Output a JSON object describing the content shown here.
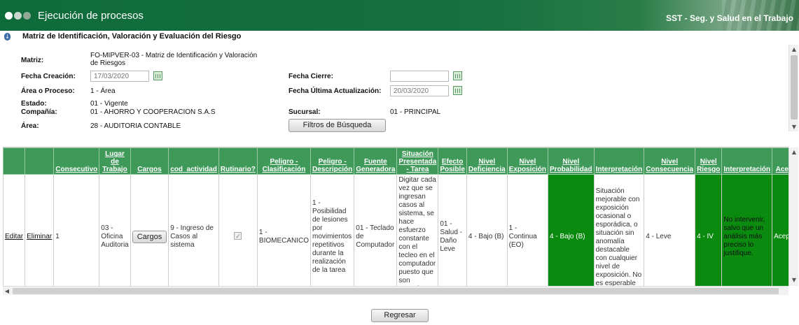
{
  "app": {
    "title": "Ejecución de procesos",
    "brand": "SST - Seg. y Salud en el Trabajo"
  },
  "page": {
    "title": "Matriz de Identificación, Valoración y Evaluación del Riesgo"
  },
  "form": {
    "matriz_label": "Matriz:",
    "matriz_value": "FO-MIPVER-03 - Matriz de Identificación y Valoración de Riesgos",
    "fecha_creacion_label": "Fecha Creación:",
    "fecha_creacion_value": "17/03/2020",
    "fecha_cierre_label": "Fecha Cierre:",
    "fecha_cierre_value": "",
    "area_proceso_label": "Área o Proceso:",
    "area_proceso_value": "1 - Área",
    "fecha_ultima_label": "Fecha Última Actualización:",
    "fecha_ultima_value": "20/03/2020",
    "estado_label": "Estado:",
    "estado_value": "01 - Vigente",
    "compania_label": "Compañía:",
    "compania_value": "01 - AHORRO Y COOPERACION S.A.S",
    "sucursal_label": "Sucursal:",
    "sucursal_value": "01 - PRINCIPAL",
    "area_label": "Área:",
    "area_value": "28 - AUDITORIA CONTABLE",
    "filtros_button": "Filtros de Búsqueda"
  },
  "table": {
    "headers": [
      "",
      "",
      "Consecutivo",
      "Lugar de Trabajo",
      "Cargos",
      "cod_actividad",
      "Rutinario?",
      "Peligro - Clasificación",
      "Peligro - Descripción",
      "Fuente Generadora",
      "Situación Presentada - Tarea",
      "Efecto Posible",
      "Nivel Deficiencia",
      "Nivel Exposición",
      "Nivel Probabilidad",
      "Interpretación",
      "Nivel Consecuencia",
      "Nivel Riesgo",
      "Interpretación",
      "Aceptab"
    ],
    "row": {
      "editar": "Editar",
      "eliminar": "Eliminar",
      "consecutivo": "1",
      "lugar": "03 - Oficina Auditoria",
      "cargos_button": "Cargos",
      "actividad": "9 - Ingreso de Casos al sistema",
      "rutinario_checked": "✓",
      "peligro_clasificacion": "1 - BIOMECANICO",
      "peligro_descripcion": "1 - Posibilidad de lesiones por movimientos repetitivos durante la realización de la tarea",
      "fuente": "01 - Teclado de Computador",
      "situacion": "Digitar cada vez que se ingresan casos al sistema, se hace esfuerzo constante con el tecleo en el computador puesto que son espacios pequeños",
      "efecto": "01 - Salud - Daño Leve",
      "deficiencia": "4 - Bajo (B)",
      "exposicion": "1 - Continua (EO)",
      "probabilidad": "4 - Bajo (B)",
      "interpretacion1": "Situación mejorable con exposición ocasional o esporádica, o situación sin anomalía destacable con cualquier nivel de exposición. No es esperable que se materialice el riesgo",
      "consecuencia": "4 - Leve",
      "riesgo": "4 - IV",
      "interpretacion2": "No intervenir, salvo que un análisis más preciso lo justifique.",
      "aceptabilidad": "Aceptable"
    }
  },
  "footer": {
    "regresar_button": "Regresar"
  },
  "colors": {
    "header_green": "#0e6b3a",
    "grid_header": "#3f9a5a",
    "risk_green": "#0a8a0f"
  }
}
